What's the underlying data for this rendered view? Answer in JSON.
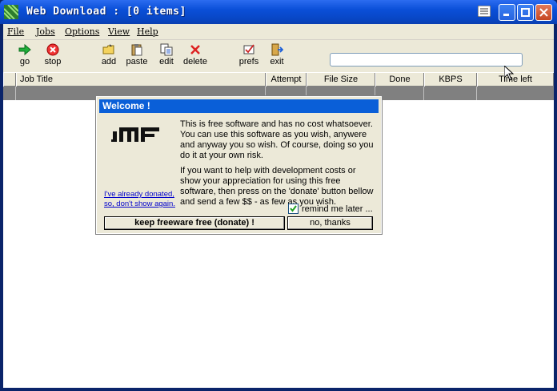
{
  "window": {
    "title": "Web Download   :   [0 items]"
  },
  "menubar": {
    "items": [
      {
        "label": "File"
      },
      {
        "label": "Jobs"
      },
      {
        "label": "Options"
      },
      {
        "label": "View"
      },
      {
        "label": "Help"
      }
    ]
  },
  "toolbar": {
    "go": "go",
    "stop": "stop",
    "add": "add",
    "paste": "paste",
    "edit": "edit",
    "delete": "delete",
    "prefs": "prefs",
    "exit": "exit",
    "url_value": ""
  },
  "table": {
    "columns": [
      "",
      "Job Title",
      "Attempt",
      "File Size",
      "Done",
      "KBPS",
      "Time left"
    ]
  },
  "dialog": {
    "title": "Welcome !",
    "logo_text": "JMF",
    "paragraph1": "This is free software and has no cost whatsoever. You can use this software as you wish, anywere and anyway you so wish. Of course, doing so you do it at your own risk.",
    "paragraph2": "If you want to help with development costs or show your appreciation for using this free software, then press on the 'donate' button bellow and send a few $$ - as few as you wish.",
    "already_donated_link": "I've already donated, so, don't show again.",
    "remind_label": "remind me later ...",
    "remind_checked": true,
    "donate_button": "keep freeware free (donate) !",
    "no_button": "no, thanks"
  },
  "colors": {
    "titlebar": "#0a4fd8",
    "dialog_title": "#0a5fd8",
    "chrome": "#ece9d8",
    "selected_row": "#808080"
  }
}
